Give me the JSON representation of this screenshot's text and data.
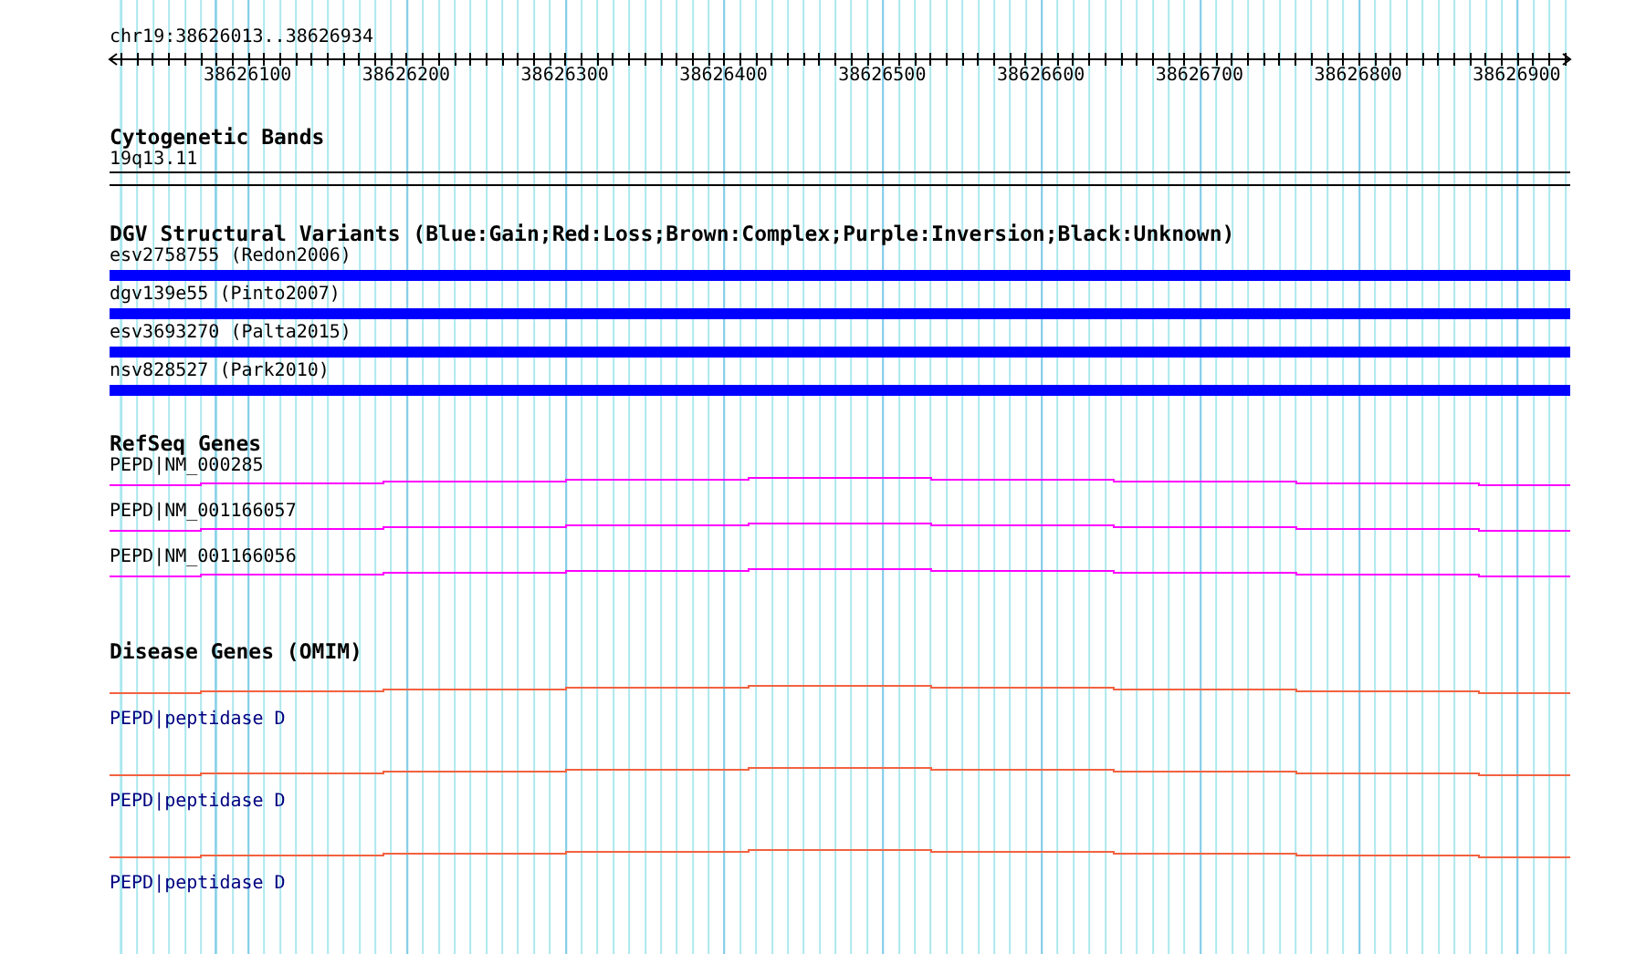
{
  "position": "chr19:38626013..38626934",
  "ruler": {
    "ticks": [
      "38626100",
      "38626200",
      "38626300",
      "38626400",
      "38626500",
      "38626600",
      "38626700",
      "38626800",
      "38626900"
    ]
  },
  "tracks": [
    {
      "kind": "bands",
      "title": "Cytogenetic Bands",
      "items": [
        {
          "label": "19q13.11"
        }
      ]
    },
    {
      "kind": "variants",
      "title": "DGV Structural Variants (Blue:Gain;Red:Loss;Brown:Complex;Purple:Inversion;Black:Unknown)",
      "items": [
        {
          "label": "esv2758755 (Redon2006)",
          "color": "#0000ff"
        },
        {
          "label": "dgv139e55 (Pinto2007)",
          "color": "#0000ff"
        },
        {
          "label": "esv3693270 (Palta2015)",
          "color": "#0000ff"
        },
        {
          "label": "nsv828527 (Park2010)",
          "color": "#0000ff"
        }
      ]
    },
    {
      "kind": "genes",
      "title": "RefSeq Genes",
      "items": [
        {
          "label": "PEPD|NM_000285"
        },
        {
          "label": "PEPD|NM_001166057"
        },
        {
          "label": "PEPD|NM_001166056"
        }
      ]
    },
    {
      "kind": "omim",
      "title": "Disease Genes (OMIM)",
      "items": [
        {
          "label": "PEPD|peptidase D"
        },
        {
          "label": "PEPD|peptidase D"
        },
        {
          "label": "PEPD|peptidase D"
        }
      ]
    }
  ]
}
